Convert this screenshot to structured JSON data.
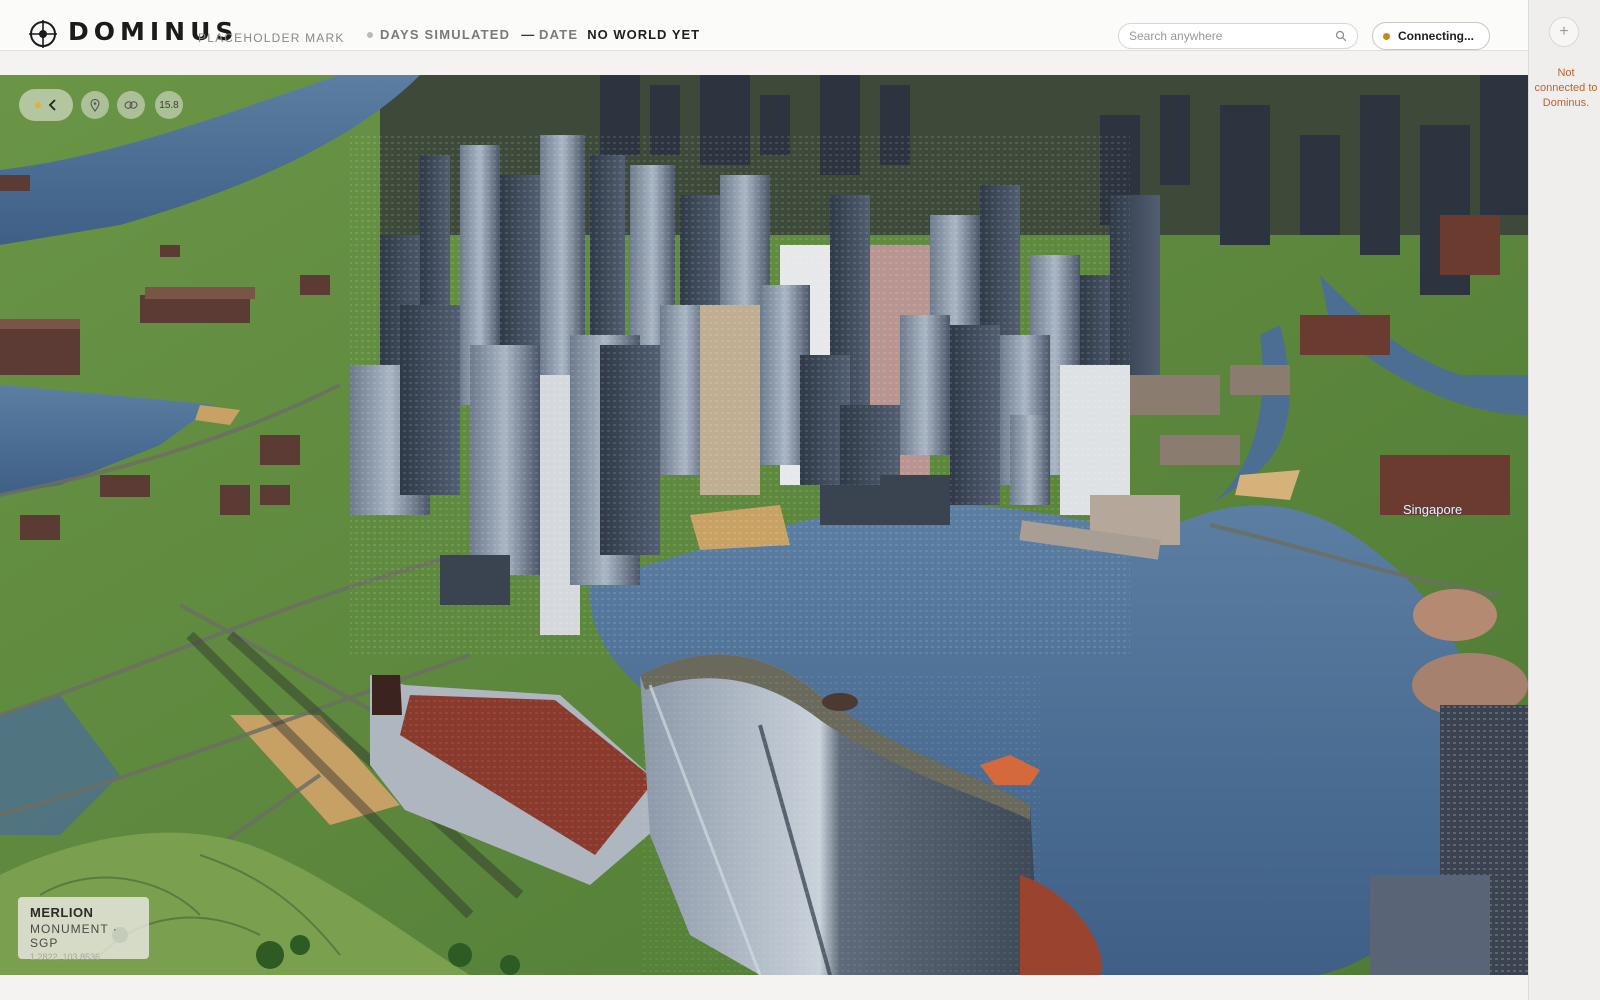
{
  "header": {
    "brand": "DOMINUS",
    "brand_tag": "PLACEHOLDER MARK",
    "days_label": "DAYS SIMULATED",
    "days_value": "—",
    "date_label": "DATE",
    "date_value": "NO WORLD YET"
  },
  "search": {
    "placeholder": "Search anywhere"
  },
  "connection": {
    "label": "Connecting...",
    "status_color": "#c38a1e"
  },
  "rail": {
    "add_label": "+",
    "message": "Not connected to Dominus."
  },
  "map_controls": {
    "zoom": "15.8",
    "icons": [
      "back-icon",
      "pin-icon",
      "link-icon"
    ]
  },
  "place": {
    "name": "MERLION",
    "type": "MONUMENT · SGP",
    "coords": "1.2822, 103.8536"
  },
  "map": {
    "label": "Singapore"
  },
  "colors": {
    "accent": "#c38a1e",
    "error": "#c0632c",
    "water": "#4a6a90",
    "land": "#5f8a3e"
  }
}
